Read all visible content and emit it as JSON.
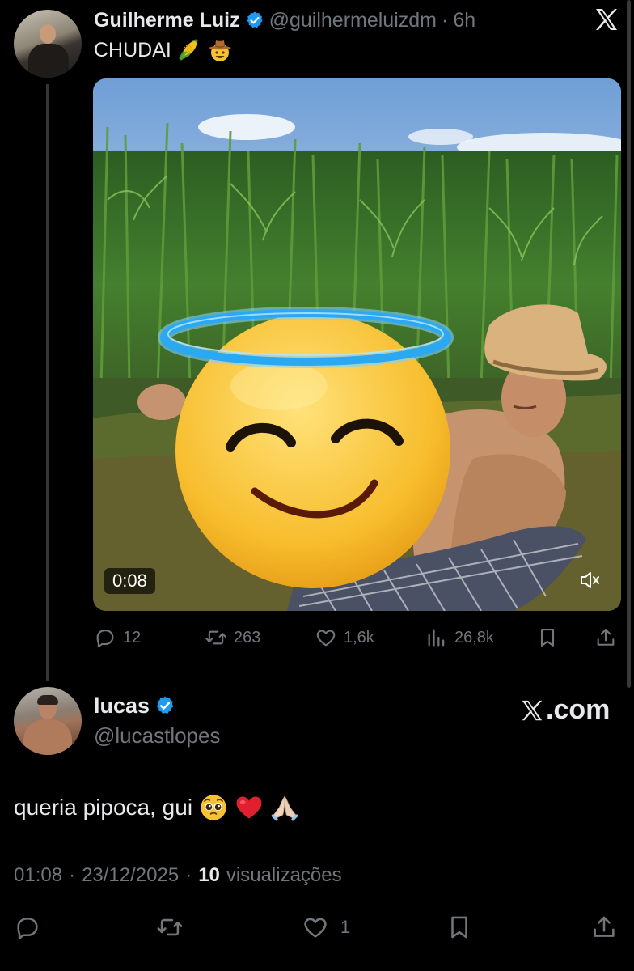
{
  "tweet": {
    "author_name": "Guilherme Luiz",
    "handle": "@guilhermeluizdm",
    "separator": "·",
    "time": "6h",
    "text": "CHUDAI",
    "text_emojis": [
      "corn-emoji",
      "cowboy-hat-face-emoji"
    ],
    "media": {
      "duration": "0:08",
      "muted": true,
      "overlay_emoji": "smiling-face-with-halo-emoji"
    },
    "stats": {
      "replies": "12",
      "retweets": "263",
      "likes": "1,6k",
      "views": "26,8k"
    }
  },
  "reply": {
    "author_name": "lucas",
    "handle": "@lucastlopes",
    "text": "queria pipoca, gui",
    "text_emojis": [
      "pleading-face-emoji",
      "red-heart-emoji",
      "folded-hands-emoji"
    ],
    "time": "01:08",
    "date": "23/12/2025",
    "separator": "·",
    "views_count": "10",
    "views_label": "visualizações",
    "likes": "1"
  },
  "branding": {
    "watermark": ".com"
  },
  "colors": {
    "background": "#000000",
    "primary_text": "#e7e9ea",
    "secondary_text": "#71767b",
    "verified_blue": "#1d9bf0",
    "thread_line": "#333639"
  },
  "icons": [
    "x-logo-icon",
    "verified-badge-icon",
    "reply-icon",
    "retweet-icon",
    "like-icon",
    "views-icon",
    "bookmark-icon",
    "share-icon",
    "mute-icon"
  ]
}
